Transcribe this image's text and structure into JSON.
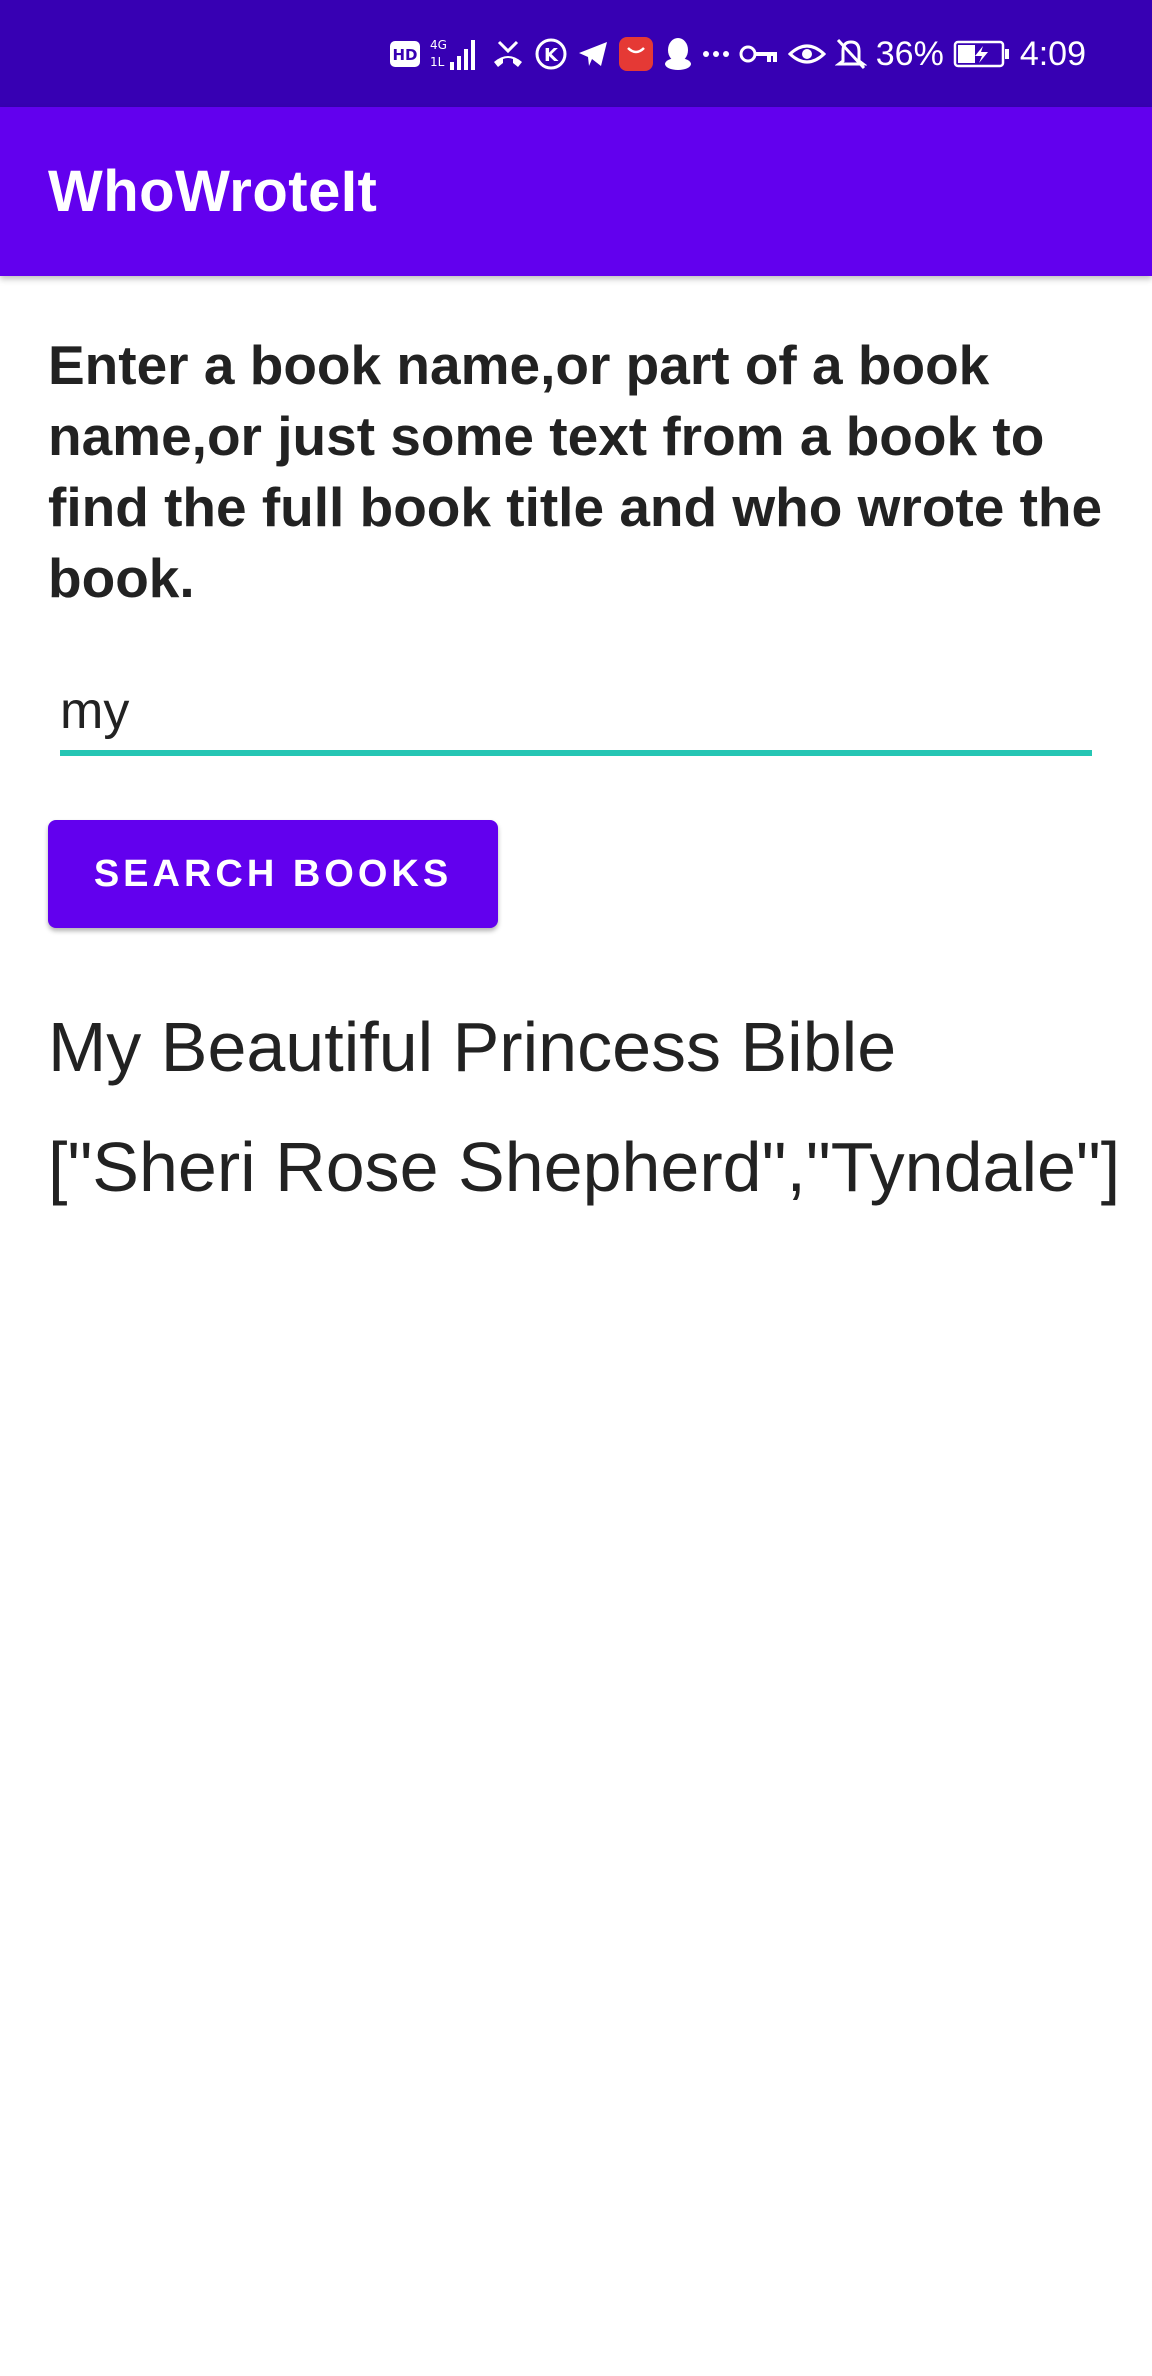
{
  "status_bar": {
    "icons": [
      "hd-icon",
      "4g-signal-icon",
      "missed-call-icon",
      "k-app-icon",
      "telegram-icon",
      "huawei-store-icon",
      "qq-icon",
      "more-dots-icon",
      "vpn-key-icon",
      "eye-icon",
      "bell-off-icon"
    ],
    "battery": "36%",
    "time": "4:09"
  },
  "app_bar": {
    "title": "WhoWroteIt"
  },
  "main": {
    "instructions": "Enter a book name,or part of a book name,or just some text from a book to find the full book title and who wrote the book.",
    "search_input_value": "my",
    "search_button_label": "SEARCH BOOKS",
    "result_title": "My Beautiful Princess Bible",
    "result_authors": "[\"Sheri Rose Shepherd\",\"Tyndale\"]"
  },
  "colors": {
    "status_bar": "#3700b3",
    "primary": "#6200ee",
    "accent_underline": "#26c6b4",
    "text": "#222222"
  }
}
